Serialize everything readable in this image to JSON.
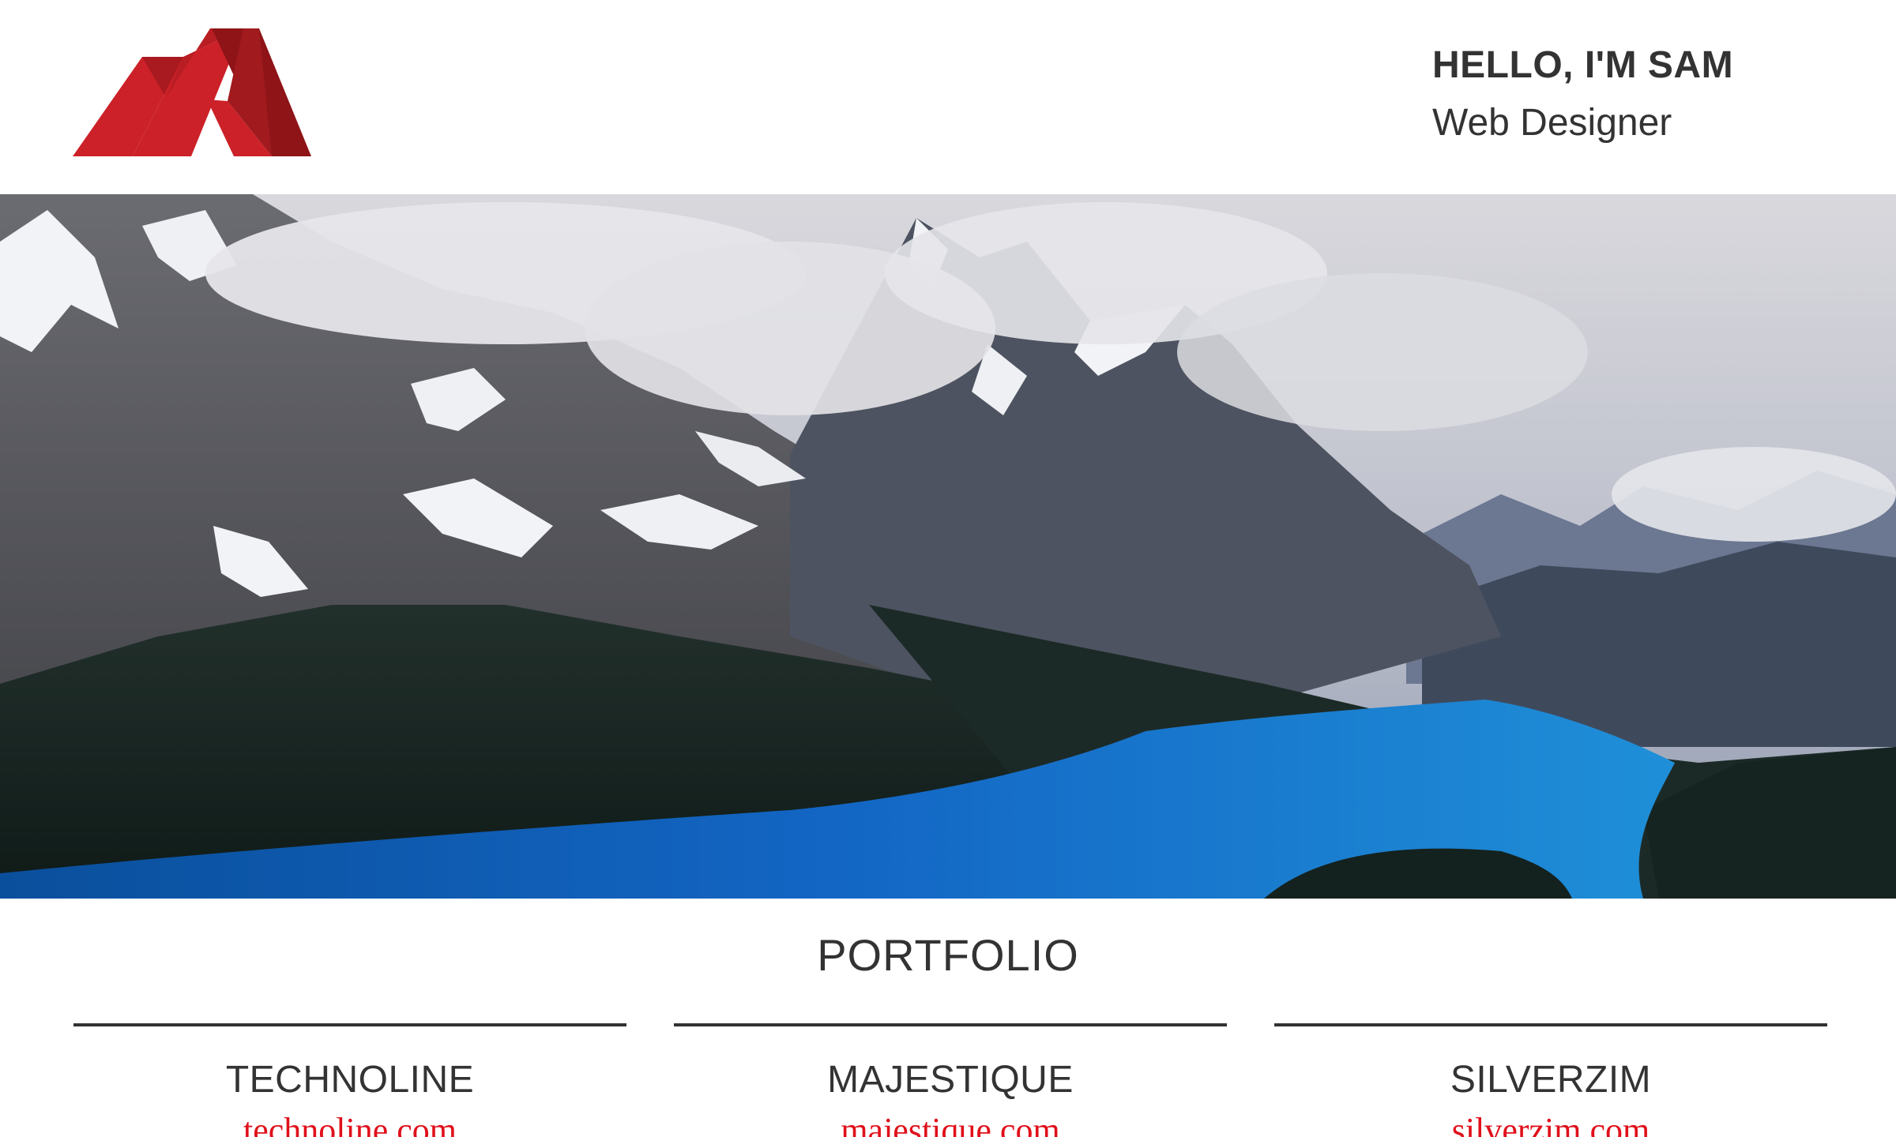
{
  "header": {
    "logo_name": "site-logo",
    "brand_colors": {
      "logo_light": "#cc2128",
      "logo_dark": "#8e1417"
    },
    "greeting": "HELLO, I'M SAM",
    "role": "Web Designer"
  },
  "hero": {
    "image_subject": "mountain-lake-landscape"
  },
  "portfolio": {
    "title": "PORTFOLIO",
    "items": [
      {
        "name": "TECHNOLINE",
        "link": "technoline.com"
      },
      {
        "name": "MAJESTIQUE",
        "link": "majestique.com"
      },
      {
        "name": "SILVERZIM",
        "link": "silverzim.com"
      }
    ]
  },
  "colors": {
    "text": "#333333",
    "link": "#e0101a",
    "background": "#ffffff"
  }
}
